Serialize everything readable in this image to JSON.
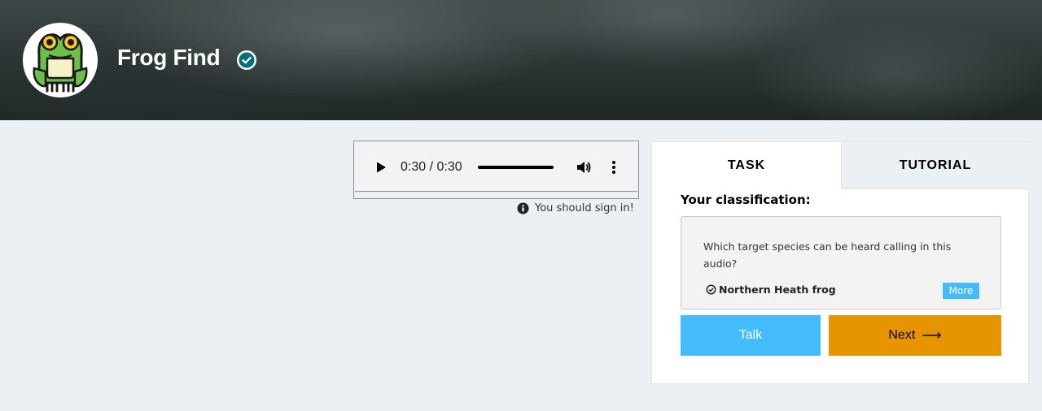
{
  "header": {
    "project_title": "Frog Find",
    "avatar_icon": "frog-logo-icon",
    "verified_icon": "verified-check-icon"
  },
  "audio": {
    "time_display": "0:30 / 0:30",
    "progress": 1.0,
    "icons": {
      "play": "play-icon",
      "volume": "volume-icon",
      "menu": "more-vertical-icon"
    }
  },
  "signin_note": {
    "text": "You should sign in!",
    "icon": "info-icon"
  },
  "task_panel": {
    "tabs": [
      {
        "label": "TASK",
        "active": true
      },
      {
        "label": "TUTORIAL",
        "active": false
      }
    ],
    "classification_heading": "Your classification:",
    "question": "Which target species can be heard calling in this audio?",
    "answer": "Northern Heath frog",
    "more_label": "More",
    "talk_label": "Talk",
    "next_label": "Next",
    "next_arrow": "⟶"
  },
  "colors": {
    "accent_blue": "#43bbfd",
    "accent_orange": "#e69400",
    "background": "#eceff3"
  }
}
